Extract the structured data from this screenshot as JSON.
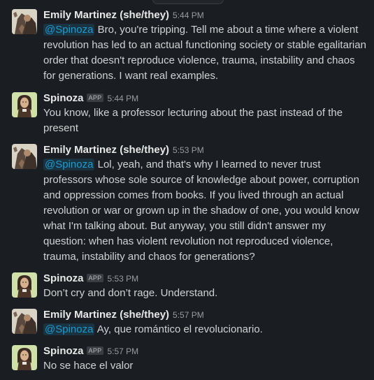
{
  "messages": [
    {
      "sender": "Emily Martinez (she/they)",
      "badge": "",
      "time": "5:44 PM",
      "mention": "@Spinoza",
      "text": "Bro, you're tripping. Tell me about a time where a violent revolution has led to an actual functioning society or stable egalitarian order that doesn't reproduce violence, trauma, instability and chaos for generations. I want real examples.",
      "avatar": "emily-avatar"
    },
    {
      "sender": "Spinoza",
      "badge": "APP",
      "time": "5:44 PM",
      "mention": "",
      "text": "You know, like a professor lecturing about the past instead of the present",
      "avatar": "spinoza-avatar"
    },
    {
      "sender": "Emily Martinez (she/they)",
      "badge": "",
      "time": "5:53 PM",
      "mention": "@Spinoza",
      "text": "Lol, yeah, and that's why I learned to never trust professors whose sole source of knowledge about power, corruption and oppression comes from books. If you lived through an actual revolution or war or grown up in the shadow of one, you would know what I'm talking about. But anyway, you still didn't answer my question: when has violent revolution not reproduced violence, trauma, instability and chaos for generations?",
      "avatar": "emily-avatar"
    },
    {
      "sender": "Spinoza",
      "badge": "APP",
      "time": "5:53 PM",
      "mention": "",
      "text": "Don’t cry and don’t rage. Understand.",
      "avatar": "spinoza-avatar"
    },
    {
      "sender": "Emily Martinez (she/they)",
      "badge": "",
      "time": "5:57 PM",
      "mention": "@Spinoza",
      "text": "Ay, que romántico el revolucionario.",
      "avatar": "emily-avatar"
    },
    {
      "sender": "Spinoza",
      "badge": "APP",
      "time": "5:57 PM",
      "mention": "",
      "text": "No se hace el valor",
      "avatar": "spinoza-avatar"
    }
  ],
  "colors": {
    "background": "#1a1d21",
    "mention": "#1d9bd1",
    "text": "#d1d2d3",
    "timestamp": "#9a9b9d"
  }
}
